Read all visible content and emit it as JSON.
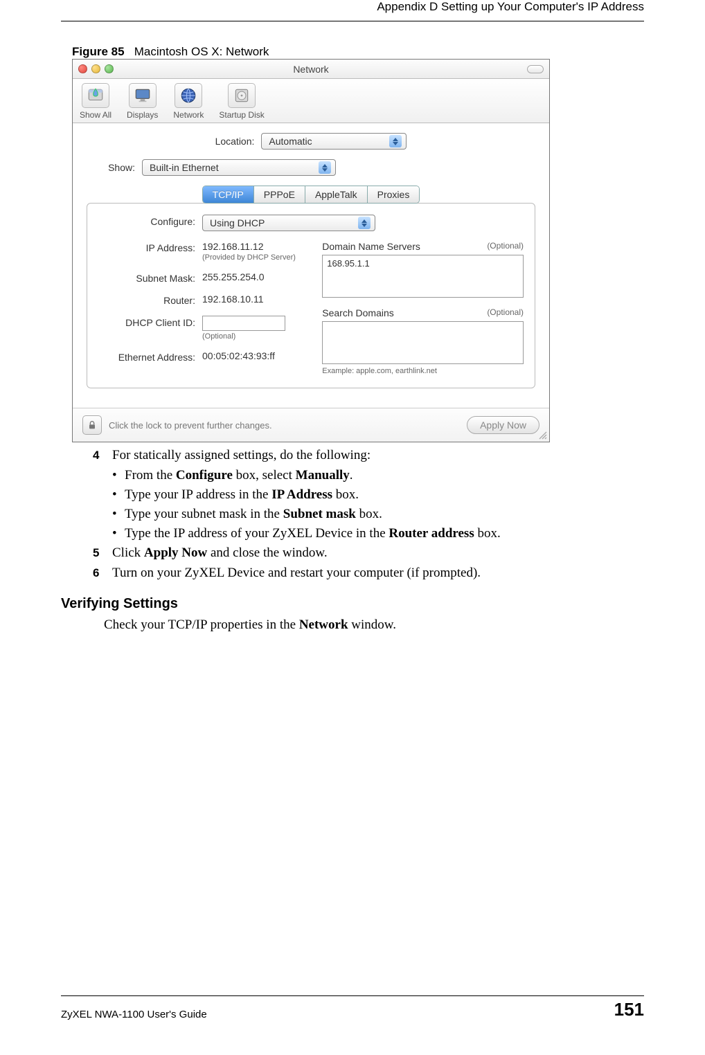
{
  "header": {
    "text": "Appendix D Setting up Your Computer's IP Address"
  },
  "figure": {
    "label": "Figure 85",
    "title": "Macintosh OS X: Network"
  },
  "mac": {
    "window_title": "Network",
    "toolbar": {
      "show_all": "Show All",
      "displays": "Displays",
      "network": "Network",
      "startup_disk": "Startup Disk"
    },
    "location_label": "Location:",
    "location_value": "Automatic",
    "show_label": "Show:",
    "show_value": "Built-in Ethernet",
    "tabs": {
      "tcpip": "TCP/IP",
      "pppoe": "PPPoE",
      "appletalk": "AppleTalk",
      "proxies": "Proxies"
    },
    "configure_label": "Configure:",
    "configure_value": "Using DHCP",
    "ip_label": "IP Address:",
    "ip_value": "192.168.11.12",
    "ip_sub": "(Provided by DHCP Server)",
    "subnet_label": "Subnet Mask:",
    "subnet_value": "255.255.254.0",
    "router_label": "Router:",
    "router_value": "192.168.10.11",
    "dhcp_label": "DHCP Client ID:",
    "dhcp_sub": "(Optional)",
    "eth_label": "Ethernet Address:",
    "eth_value": "00:05:02:43:93:ff",
    "dns_label": "Domain Name Servers",
    "dns_opt": "(Optional)",
    "dns_value": "168.95.1.1",
    "search_label": "Search Domains",
    "search_opt": "(Optional)",
    "example_text": "Example: apple.com, earthlink.net",
    "lock_text": "Click the lock to prevent further changes.",
    "apply_text": "Apply Now"
  },
  "steps": {
    "s4": "For statically assigned settings, do the following:",
    "b1a": "From the ",
    "b1b": "Configure",
    "b1c": " box, select ",
    "b1d": "Manually",
    "b1e": ".",
    "b2a": "Type your IP address in the ",
    "b2b": "IP Address",
    "b2c": " box.",
    "b3a": "Type your subnet mask in the ",
    "b3b": "Subnet mask",
    "b3c": " box.",
    "b4a": "Type the IP address of your ZyXEL Device in the ",
    "b4b": "Router address",
    "b4c": " box.",
    "s5a": "Click ",
    "s5b": "Apply Now",
    "s5c": " and close the window.",
    "s6": "Turn on your ZyXEL Device and restart your computer (if prompted)."
  },
  "section": {
    "heading": "Verifying Settings",
    "para_a": "Check your TCP/IP properties in the ",
    "para_b": "Network",
    "para_c": " window."
  },
  "footer": {
    "left": "ZyXEL NWA-1100 User's Guide",
    "right": "151"
  }
}
